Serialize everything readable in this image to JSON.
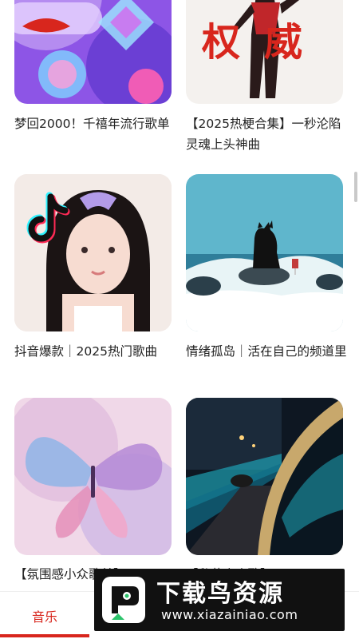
{
  "cards": [
    {
      "title": "梦回2000！千禧年流行歌单"
    },
    {
      "title": "【2025热梗合集】一秒沦陷灵魂上头神曲",
      "cover_text": "权威"
    },
    {
      "title": "抖音爆款｜2025热门歌曲"
    },
    {
      "title": "情绪孤岛｜活在自己的频道里"
    },
    {
      "title": "【氛围感小众歌单】"
    },
    {
      "title": "【私藏小众歌】"
    }
  ],
  "bottom_nav": {
    "tab_music": "音乐"
  },
  "watermark": {
    "title": "下载鸟资源",
    "url": "www.xiazainiao.com"
  },
  "colors": {
    "accent": "#d8261d",
    "watermark_bg": "#111111",
    "text": "#222222"
  }
}
